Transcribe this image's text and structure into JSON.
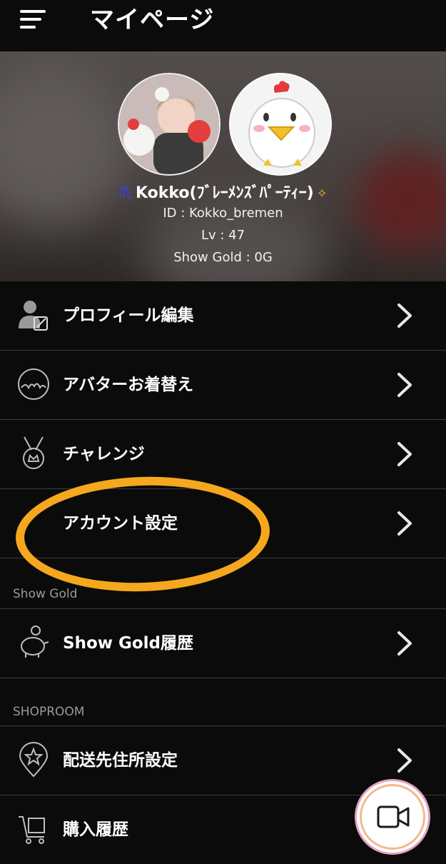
{
  "header": {
    "title": "マイページ"
  },
  "profile": {
    "zodiac_symbol": "♏",
    "name": "Kokko(ﾌﾞﾚｰﾒﾝｽﾞﾊﾟｰﾃｨｰ)",
    "sparkle": "✧",
    "id_line": "ID : Kokko_bremen",
    "level_line": "Lv : 47",
    "gold_line": "Show Gold : 0G"
  },
  "menu": {
    "profile_edit": "プロフィール編集",
    "avatar_change": "アバターお着替え",
    "challenge": "チャレンジ",
    "account_settings": "アカウント設定",
    "show_gold_history": "Show Gold履歴",
    "shipping_address": "配送先住所設定",
    "purchase_history": "購入履歴"
  },
  "sections": {
    "show_gold": "Show Gold",
    "shoproom": "SHOPROOM"
  },
  "colors": {
    "highlight": "#f5a71e",
    "background": "#0b0b0b",
    "divider": "#3c3c3c"
  }
}
